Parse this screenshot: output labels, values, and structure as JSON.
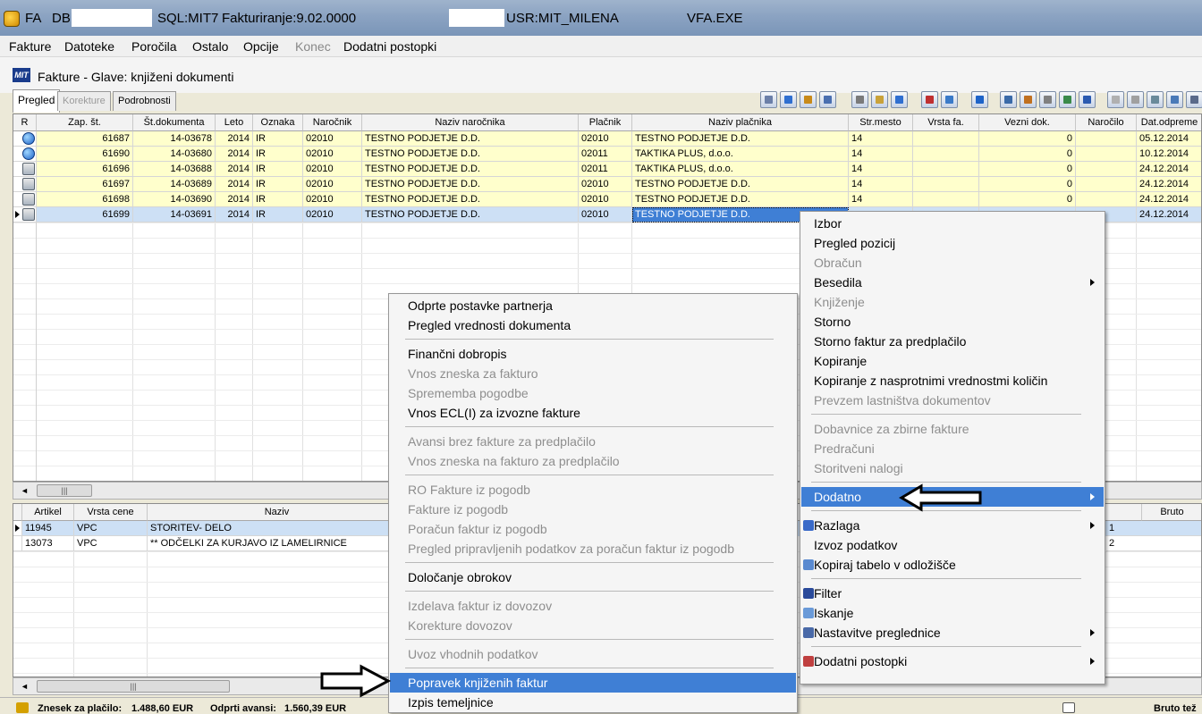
{
  "titlebar": {
    "app": "FA",
    "db_label": "DB:",
    "sql": "SQL:MIT7",
    "version": "Fakturiranje:9.02.0000",
    "user": "USR:MIT_MILENA",
    "exe": "VFA.EXE"
  },
  "menubar": [
    {
      "label": "Fakture",
      "disabled": false
    },
    {
      "label": "Datoteke",
      "disabled": false
    },
    {
      "label": "Poročila",
      "disabled": false
    },
    {
      "label": "Ostalo",
      "disabled": false
    },
    {
      "label": "Opcije",
      "disabled": false
    },
    {
      "label": "Konec",
      "disabled": true
    },
    {
      "label": "Dodatni postopki",
      "disabled": false
    }
  ],
  "document": {
    "logo": "MIT",
    "title": "Fakture - Glave: knjiženi dokumenti"
  },
  "tabs": [
    {
      "label": "Pregled",
      "active": true,
      "disabled": false
    },
    {
      "label": "Korekture",
      "active": false,
      "disabled": true
    },
    {
      "label": "Podrobnosti",
      "active": false,
      "disabled": false
    }
  ],
  "toolbar_icons": [
    "page-icon",
    "refresh-icon",
    "columns-icon",
    "list-icon",
    "copy-icon",
    "open-folder-icon",
    "tool-icon",
    "pdf-icon",
    "transfer-icon",
    "ie-icon",
    "window-icon",
    "table-icon",
    "attach-icon",
    "export-icon",
    "help-icon",
    "blank-page-icon",
    "folder-icon",
    "print-icon",
    "search-icon",
    "calculator-icon"
  ],
  "top_grid": {
    "columns": [
      "R",
      "Zap. št.",
      "Št.dokumenta",
      "Leto",
      "Oznaka",
      "Naročnik",
      "Naziv naročnika",
      "Plačnik",
      "Naziv plačnika",
      "Str.mesto",
      "Vrsta fa.",
      "Vezni dok.",
      "Naročilo",
      "Dat.odpreme"
    ],
    "rows": [
      {
        "icon": "ie-icon",
        "zap": "61687",
        "dok": "14-03678",
        "leto": "2014",
        "oznaka": "IR",
        "narocnik": "02010",
        "naziv_narocnika": "TESTNO PODJETJE D.D.",
        "placnik": "02010",
        "naziv_placnika": "TESTNO PODJETJE D.D.",
        "strmesto": "14",
        "vrsta": "",
        "vezni": "0",
        "narocilo": "",
        "datum": "05.12.2014"
      },
      {
        "icon": "ie-icon",
        "zap": "61690",
        "dok": "14-03680",
        "leto": "2014",
        "oznaka": "IR",
        "narocnik": "02010",
        "naziv_narocnika": "TESTNO PODJETJE D.D.",
        "placnik": "02011",
        "naziv_placnika": "TAKTIKA PLUS, d.o.o.",
        "strmesto": "14",
        "vrsta": "",
        "vezni": "0",
        "narocilo": "",
        "datum": "10.12.2014"
      },
      {
        "icon": "print-icon",
        "zap": "61696",
        "dok": "14-03688",
        "leto": "2014",
        "oznaka": "IR",
        "narocnik": "02010",
        "naziv_narocnika": "TESTNO PODJETJE D.D.",
        "placnik": "02011",
        "naziv_placnika": "TAKTIKA PLUS, d.o.o.",
        "strmesto": "14",
        "vrsta": "",
        "vezni": "0",
        "narocilo": "",
        "datum": "24.12.2014"
      },
      {
        "icon": "print-icon",
        "zap": "61697",
        "dok": "14-03689",
        "leto": "2014",
        "oznaka": "IR",
        "narocnik": "02010",
        "naziv_narocnika": "TESTNO PODJETJE D.D.",
        "placnik": "02010",
        "naziv_placnika": "TESTNO PODJETJE D.D.",
        "strmesto": "14",
        "vrsta": "",
        "vezni": "0",
        "narocilo": "",
        "datum": "24.12.2014"
      },
      {
        "icon": "print-icon",
        "zap": "61698",
        "dok": "14-03690",
        "leto": "2014",
        "oznaka": "IR",
        "narocnik": "02010",
        "naziv_narocnika": "TESTNO PODJETJE D.D.",
        "placnik": "02010",
        "naziv_placnika": "TESTNO PODJETJE D.D.",
        "strmesto": "14",
        "vrsta": "",
        "vezni": "0",
        "narocilo": "",
        "datum": "24.12.2014"
      },
      {
        "icon": "print-icon",
        "zap": "61699",
        "dok": "14-03691",
        "leto": "2014",
        "oznaka": "IR",
        "narocnik": "02010",
        "naziv_narocnika": "TESTNO PODJETJE D.D.",
        "placnik": "02010",
        "naziv_placnika": "TESTNO PODJETJE D.D.",
        "strmesto": "",
        "vrsta": "",
        "vezni": "",
        "narocilo": "",
        "datum": "24.12.2014"
      }
    ]
  },
  "bottom_grid": {
    "columns": [
      "Artikel",
      "Vrsta cene",
      "Naziv",
      "Bruto"
    ],
    "rows": [
      {
        "artikel": "11945",
        "vrsta": "VPC",
        "naziv": "STORITEV- DELO",
        "bruto": "1"
      },
      {
        "artikel": "13073",
        "vrsta": "VPC",
        "naziv": "** ODČELKI ZA KURJAVO IZ LAMELIRNICE",
        "bruto": "2"
      }
    ]
  },
  "statusbar": {
    "zneska_label": "Znesek za plačilo:",
    "zneska_value": "1.488,60 EUR",
    "avansi_label": "Odprti avansi:",
    "avansi_value": "1.560,39 EUR",
    "bruto_label": "Bruto tež"
  },
  "context_menu_left": [
    {
      "label": "Odprte postavke partnerja",
      "disabled": false
    },
    {
      "label": "Pregled vrednosti dokumenta",
      "disabled": false
    },
    {
      "sep": true
    },
    {
      "label": "Finančni dobropis",
      "disabled": false
    },
    {
      "label": "Vnos zneska za fakturo",
      "disabled": true
    },
    {
      "label": "Sprememba pogodbe",
      "disabled": true
    },
    {
      "label": "Vnos ECL(I) za izvozne fakture",
      "disabled": false
    },
    {
      "sep": true
    },
    {
      "label": "Avansi brez fakture za predplačilo",
      "disabled": true
    },
    {
      "label": "Vnos zneska na fakturo za predplačilo",
      "disabled": true
    },
    {
      "sep": true
    },
    {
      "label": "RO Fakture iz pogodb",
      "disabled": true
    },
    {
      "label": "Fakture iz pogodb",
      "disabled": true
    },
    {
      "label": "Poračun faktur iz pogodb",
      "disabled": true
    },
    {
      "label": "Pregled pripravljenih podatkov za poračun faktur iz pogodb",
      "disabled": true
    },
    {
      "sep": true
    },
    {
      "label": "Določanje obrokov",
      "disabled": false
    },
    {
      "sep": true
    },
    {
      "label": "Izdelava faktur iz dovozov",
      "disabled": true
    },
    {
      "label": "Korekture dovozov",
      "disabled": true
    },
    {
      "sep": true
    },
    {
      "label": "Uvoz vhodnih podatkov",
      "disabled": true
    },
    {
      "sep": true
    },
    {
      "label": "Popravek knjiženih faktur",
      "disabled": false,
      "highlight": true
    },
    {
      "label": "Izpis temeljnice",
      "disabled": false
    }
  ],
  "context_menu_right": [
    {
      "label": "Izbor",
      "disabled": false
    },
    {
      "label": "Pregled pozicij",
      "disabled": false
    },
    {
      "label": "Obračun",
      "disabled": true
    },
    {
      "label": "Besedila",
      "disabled": false,
      "sub": true
    },
    {
      "label": "Knjiženje",
      "disabled": true
    },
    {
      "label": "Storno",
      "disabled": false
    },
    {
      "label": "Storno faktur za predplačilo",
      "disabled": false
    },
    {
      "label": "Kopiranje",
      "disabled": false
    },
    {
      "label": "Kopiranje z nasprotnimi vrednostmi količin",
      "disabled": false
    },
    {
      "label": "Prevzem lastništva dokumentov",
      "disabled": true
    },
    {
      "sep": true
    },
    {
      "label": "Dobavnice za zbirne fakture",
      "disabled": true
    },
    {
      "label": "Predračuni",
      "disabled": true
    },
    {
      "label": "Storitveni nalogi",
      "disabled": true
    },
    {
      "sep": true
    },
    {
      "label": "Dodatno",
      "disabled": false,
      "sub": true,
      "highlight": true
    },
    {
      "sep": true
    },
    {
      "label": "Razlaga",
      "disabled": false,
      "sub": true,
      "icon": "help-icon"
    },
    {
      "label": "Izvoz podatkov",
      "disabled": false
    },
    {
      "label": "Kopiraj tabelo v odložišče",
      "disabled": false,
      "icon": "clipboard-icon"
    },
    {
      "sep": true
    },
    {
      "label": "Filter",
      "disabled": false,
      "icon": "filter-icon"
    },
    {
      "label": "Iskanje",
      "disabled": false,
      "icon": "search-icon"
    },
    {
      "label": "Nastavitve preglednice",
      "disabled": false,
      "sub": true,
      "icon": "grid-settings-icon"
    },
    {
      "sep": true
    },
    {
      "label": "Dodatni postopki",
      "disabled": false,
      "sub": true,
      "icon": "tools-icon"
    }
  ],
  "colors": {
    "row_yellow": "#ffffcc",
    "row_selected": "#cde0f5",
    "menu_highlight": "#3f7fd5"
  }
}
